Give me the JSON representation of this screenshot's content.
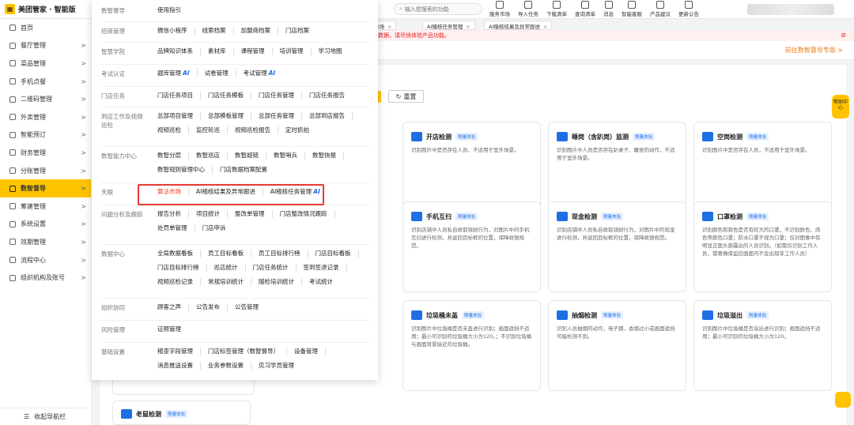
{
  "app": {
    "title": "美团管家 · 智能版"
  },
  "search": {
    "placeholder": "输入想搜索的功能"
  },
  "toolbar": [
    {
      "label": "服务市场",
      "icon": "store-icon"
    },
    {
      "label": "导入任务",
      "icon": "import-icon"
    },
    {
      "label": "下载清单",
      "icon": "download-icon"
    },
    {
      "label": "查询清单",
      "icon": "list-icon"
    },
    {
      "label": "消息",
      "icon": "bell-icon"
    },
    {
      "label": "智能客服",
      "icon": "headset-icon"
    },
    {
      "label": "产品建议",
      "icon": "feedback-icon"
    },
    {
      "label": "更新公告",
      "icon": "announcement-icon"
    }
  ],
  "sidebar": {
    "items": [
      {
        "label": "首页",
        "arrow": ""
      },
      {
        "label": "餐厅管理",
        "arrow": ">"
      },
      {
        "label": "菜品管理",
        "arrow": ">"
      },
      {
        "label": "手机点餐",
        "arrow": ">"
      },
      {
        "label": "二维码管理",
        "arrow": ">"
      },
      {
        "label": "外卖管理",
        "arrow": ">"
      },
      {
        "label": "智能预订",
        "arrow": ">"
      },
      {
        "label": "财务管理",
        "arrow": ">"
      },
      {
        "label": "分账管理",
        "arrow": ">"
      },
      {
        "label": "数智督导",
        "arrow": ">"
      },
      {
        "label": "筹建管理",
        "arrow": ">"
      },
      {
        "label": "系统设置",
        "arrow": ">"
      },
      {
        "label": "效期管理",
        "arrow": ">"
      },
      {
        "label": "流程中心",
        "arrow": ">"
      },
      {
        "label": "组织机构及账号",
        "arrow": ">"
      }
    ],
    "active_index": 9,
    "collapse_label": "收起导航栏"
  },
  "tabs": [
    {
      "label": "算法市场",
      "close": "×"
    },
    {
      "label": "AI稽核任务管理",
      "close": "×"
    },
    {
      "label": "AI稽核结果及异常跟进",
      "close": "×"
    }
  ],
  "notice": {
    "text": "数据，请尽快体验产品功能。"
  },
  "main": {
    "goto_link": "前往数智督导专版 >",
    "reset_label": "重置"
  },
  "cards": [
    {
      "title": "开店检测",
      "badge": "限量体验",
      "desc": "识别图片中是否存在人员、不适用于室外场景。"
    },
    {
      "title": "睡岗（含趴岗）监测",
      "badge": "限量体验",
      "desc": "识别图片中人员是否存在趴桌子、睡觉的动作，不适用于室外场景。"
    },
    {
      "title": "空岗检测",
      "badge": "限量体验",
      "desc": "识别图片中是否存在人员，不适用于室外场景。"
    },
    {
      "title": "手机互扫",
      "badge": "限量体验",
      "desc": "识别店铺中人员私自收取钱财行为，对图片中的手机互扫进行检测，并返回目标框的位置，保障收银规范。"
    },
    {
      "title": "现金检测",
      "badge": "限量体验",
      "desc": "识别店铺中人员私自收取钱财行为，对图片中的现金进行检测，并返回目标框的位置，保障收银规范。"
    },
    {
      "title": "口罩检测",
      "badge": "限量体验",
      "desc": "识别颜色和款色是否有较大的口罩，不识别肤色、肉色等颜色口罩；防水口罩不视为口罩；仅对图像中有明显正面头部露出的人员识别。（如需仅识别工作人员，需要确保监控画面内不会出现非工作人员）"
    },
    {
      "title": "垃圾桶未盖",
      "badge": "限量体验",
      "desc": "识别图片中垃圾桶是否未盖进行识别；画面遮挡不适用；最小可识别的垃圾桶大小为120。；不识别垃圾桶与画面背景接近的垃圾桶。"
    },
    {
      "title": "抽烟检测",
      "badge": "限量体验",
      "desc": "识别人员抽烟的动作，电子烟，香烟过小或画面遮挡可能检测不到。"
    },
    {
      "title": "垃圾溢出",
      "badge": "限量体验",
      "desc": "识别图片中垃圾桶是否溢出进行识别；画面遮挡不适用；最小可识别的垃圾桶大小为120。"
    },
    {
      "title": "老鼠检测",
      "badge": "限量体验",
      "desc": ""
    }
  ],
  "menu": [
    {
      "category": "数智督导",
      "links": [
        {
          "label": "使用指引"
        }
      ]
    },
    {
      "category": "招商管理",
      "links": [
        {
          "label": "微信小程序"
        },
        {
          "label": "线索档案"
        },
        {
          "label": "加盟商档案"
        },
        {
          "label": "门店档案"
        }
      ]
    },
    {
      "category": "智慧学院",
      "links": [
        {
          "label": "品牌知识体系"
        },
        {
          "label": "素材库"
        },
        {
          "label": "课程管理"
        },
        {
          "label": "培训管理"
        },
        {
          "label": "学习地图"
        }
      ]
    },
    {
      "category": "考试认证",
      "links": [
        {
          "label": "题库管理",
          "ai": "AI"
        },
        {
          "label": "试卷管理"
        },
        {
          "label": "考试管理",
          "ai": "AI"
        }
      ]
    },
    {
      "category": "门店任务",
      "links": [
        {
          "label": "门店任务项目"
        },
        {
          "label": "门店任务模板"
        },
        {
          "label": "门店任务管理"
        },
        {
          "label": "门店任务报告"
        }
      ]
    },
    {
      "category": "到店工作及视频巡检",
      "links": [
        {
          "label": "总部项目管理"
        },
        {
          "label": "总部模板管理"
        },
        {
          "label": "总部任务管理"
        },
        {
          "label": "总部到店报告"
        },
        {
          "label": "视频巡检"
        },
        {
          "label": "监控轮巡"
        },
        {
          "label": "视频巡检报告"
        },
        {
          "label": "定时抓拍"
        }
      ]
    },
    {
      "category": "数智能力中心",
      "links": [
        {
          "label": "数智分层"
        },
        {
          "label": "数智巡店"
        },
        {
          "label": "数智超链"
        },
        {
          "label": "数智哨兵"
        },
        {
          "label": "数智快报"
        },
        {
          "label": "数智规则管理中心"
        },
        {
          "label": "门店数据档案配置"
        }
      ]
    },
    {
      "category": "天眼",
      "links": [
        {
          "label": "算法市场",
          "red": true
        },
        {
          "label": "AI稽核结果及异常跟进"
        },
        {
          "label": "AI稽核任务管理",
          "ai": "AI"
        }
      ]
    },
    {
      "category": "问题分析及跟踪",
      "links": [
        {
          "label": "报告分析"
        },
        {
          "label": "项目统计"
        },
        {
          "label": "整改单管理"
        },
        {
          "label": "门店整改情况跟踪"
        },
        {
          "label": "处罚单管理"
        },
        {
          "label": "门店申诉"
        }
      ]
    },
    {
      "category": "数据中心",
      "links": [
        {
          "label": "全局数据看板"
        },
        {
          "label": "员工目标看板"
        },
        {
          "label": "员工目标排行榜"
        },
        {
          "label": "门店目标看板"
        },
        {
          "label": "门店目标排行榜"
        },
        {
          "label": "巡店统计"
        },
        {
          "label": "门店任务统计"
        },
        {
          "label": "签到签退记录"
        },
        {
          "label": "视频巡检记录"
        },
        {
          "label": "常规培训统计"
        },
        {
          "label": "随检培训统计"
        },
        {
          "label": "考试统计"
        }
      ]
    },
    {
      "category": "组织协同",
      "links": [
        {
          "label": "顾客之声"
        },
        {
          "label": "公告发布"
        },
        {
          "label": "公告管理"
        }
      ]
    },
    {
      "category": "风险管理",
      "links": [
        {
          "label": "证照管理"
        }
      ]
    },
    {
      "category": "基础设置",
      "links": [
        {
          "label": "稽查字段管理"
        },
        {
          "label": "门店标签管理（数智督导）"
        },
        {
          "label": "设备管理"
        },
        {
          "label": "消息推送设置"
        },
        {
          "label": "业务参数设置"
        },
        {
          "label": "见习学员管理"
        }
      ]
    }
  ],
  "help": {
    "label": "帮助中心"
  }
}
